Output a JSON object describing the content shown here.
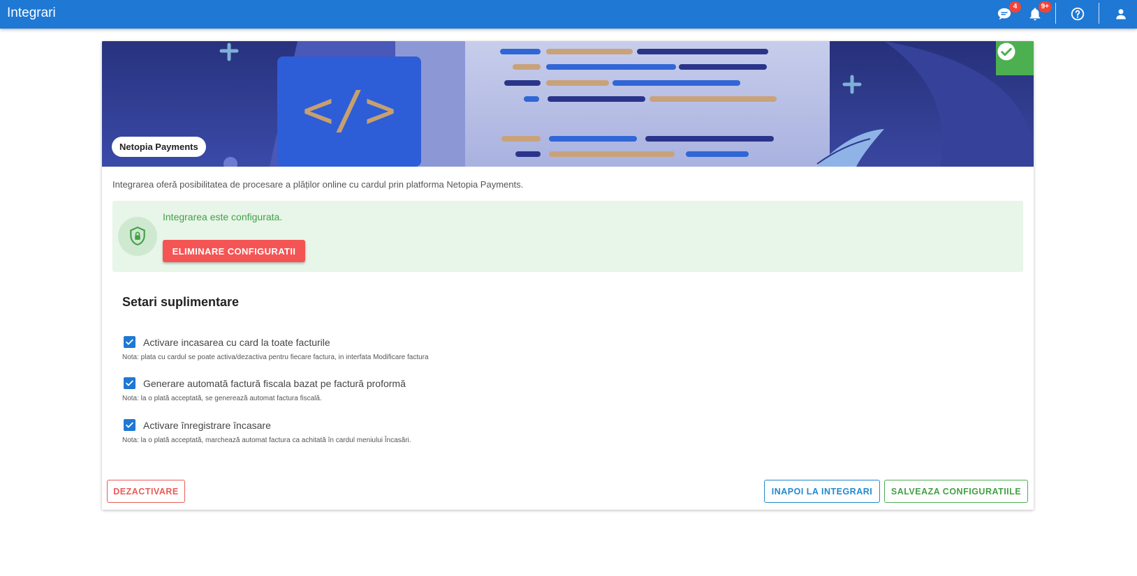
{
  "app": {
    "title": "Integrari"
  },
  "topbar": {
    "chat_badge": "4",
    "notifications_badge": "9+",
    "icons": [
      "chat-icon",
      "bell-icon",
      "help-icon",
      "account-icon"
    ]
  },
  "integration": {
    "name": "Netopia Payments",
    "description": "Integrarea oferă posibilitatea de procesare a plăților online cu cardul prin platforma Netopia Payments.",
    "status": "configured"
  },
  "configured_box": {
    "message": "Integrarea este configurata.",
    "remove_button": "ELIMINARE CONFIGURATII"
  },
  "settings": {
    "title": "Setari suplimentare",
    "options": [
      {
        "label": "Activare incasarea cu card la toate facturile",
        "note": "Nota: plata cu cardul se poate activa/dezactiva pentru fiecare factura, in interfata Modificare factura",
        "checked": true
      },
      {
        "label": "Generare automată factură fiscala bazat pe factură proformă",
        "note": "Nota: la o plată acceptată, se generează automat factura fiscală.",
        "checked": true
      },
      {
        "label": "Activare înregistrare încasare",
        "note": "Nota: la o plată acceptată, marchează automat factura ca achitată în cardul meniului Încasări.",
        "checked": true
      }
    ]
  },
  "actions": {
    "deactivate": "DEZACTIVARE",
    "back": "INAPOI LA INTEGRARI",
    "save": "SALVEAZA CONFIGURATIILE"
  },
  "colors": {
    "primary": "#1e78d4",
    "success": "#4caf50",
    "danger": "#f45554",
    "success_bg": "#e8f5e9"
  }
}
